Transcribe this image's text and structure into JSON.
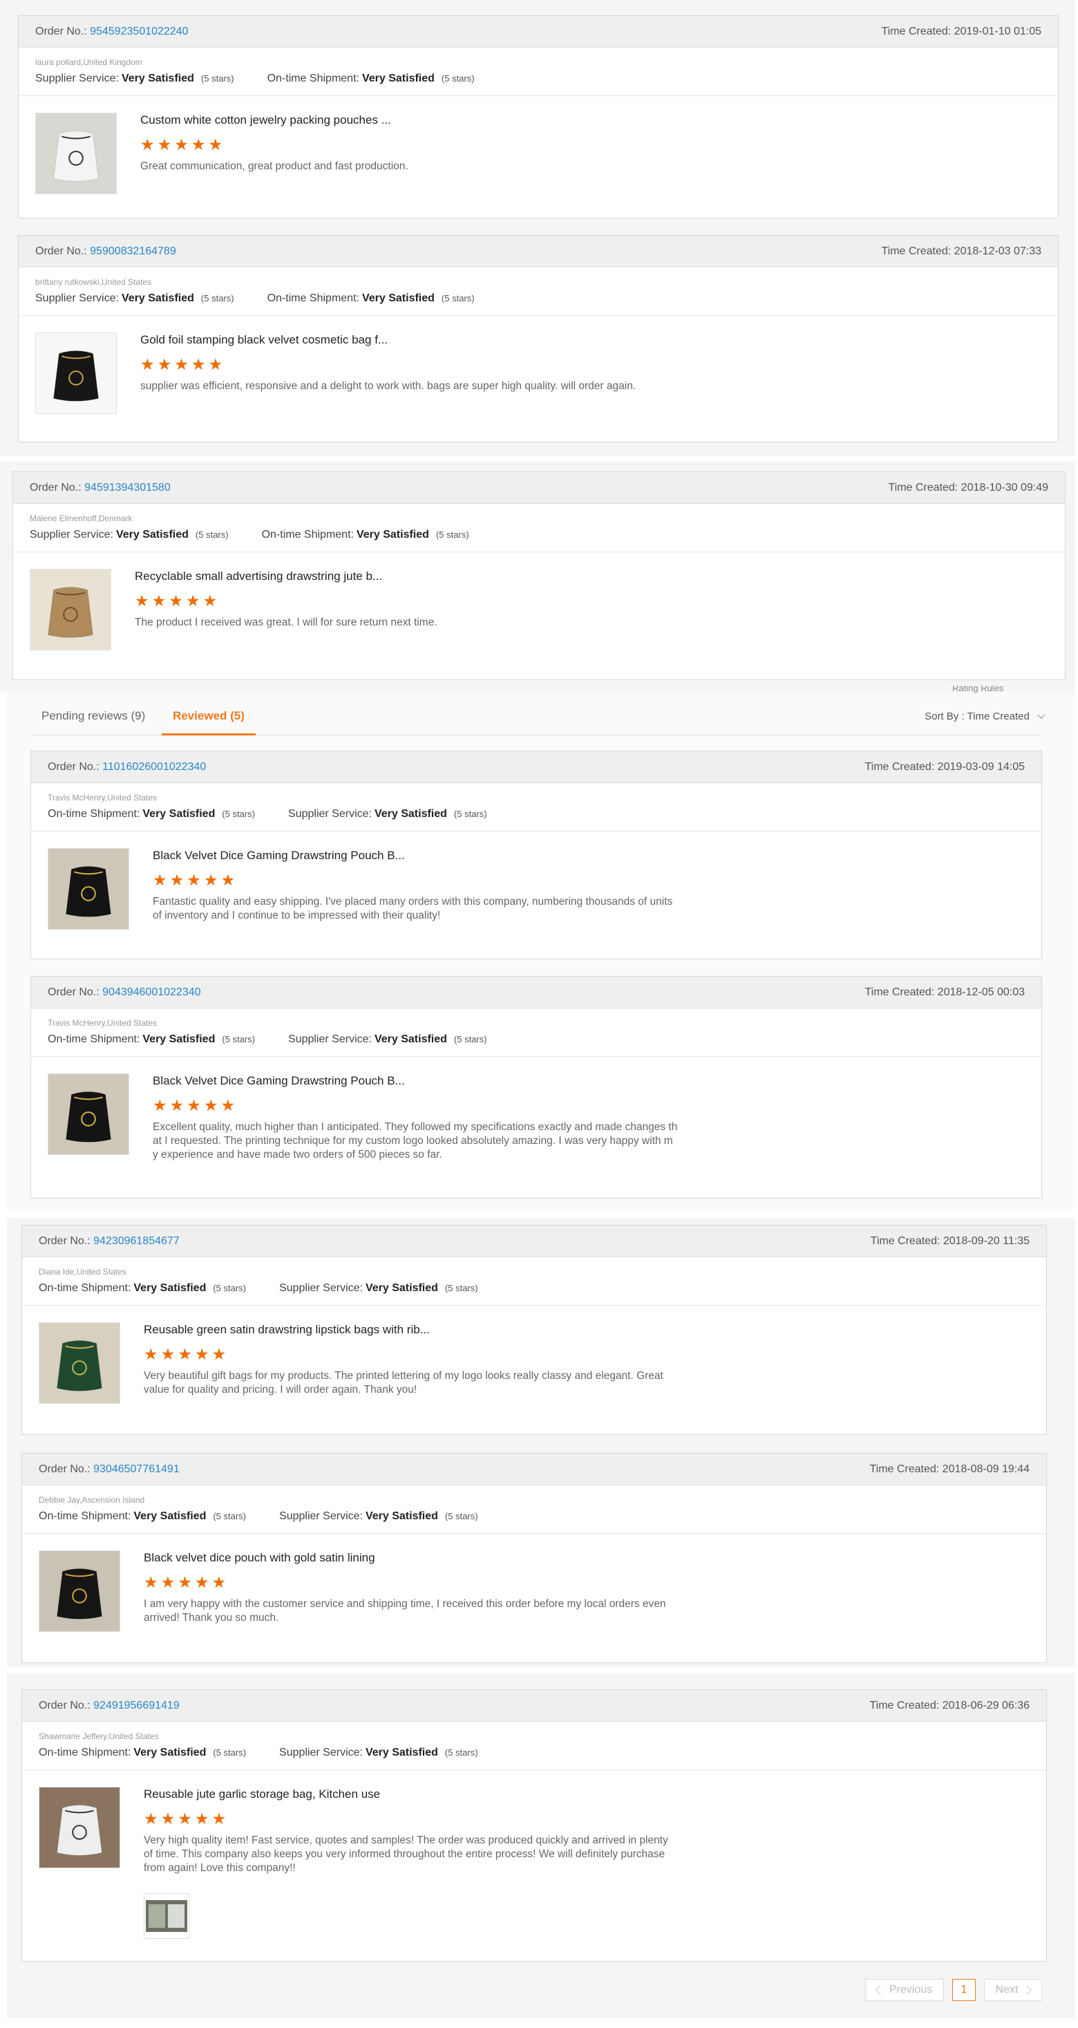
{
  "labels": {
    "order_no": "Order No.:",
    "time_created": "Time Created:",
    "supplier_service": "Supplier Service:",
    "ontime_shipment": "On-time Shipment:"
  },
  "tabs": {
    "pending": "Pending reviews (9)",
    "reviewed": "Reviewed (5)",
    "sort_by": "Sort By : Time Created",
    "rating_rules": "Rating Rules"
  },
  "pagination": {
    "previous": "Previous",
    "page": "1",
    "next": "Next"
  },
  "colors": {
    "accent": "#f07a1c",
    "link": "#2a86c9",
    "star": "#f06c00"
  },
  "orders": [
    {
      "order_no": "9545923501022240",
      "time": "2019-01-10 01:05",
      "buyer": "laura pollard,United Kingdom",
      "first": {
        "label": "Supplier Service:",
        "value": "Very Satisfied",
        "stars": "(5 stars)"
      },
      "second": {
        "label": "On-time Shipment:",
        "value": "Very Satisfied",
        "stars": "(5 stars)"
      },
      "product": "Custom white cotton jewelry packing pouches ...",
      "review": "Great communication, great product and fast production.",
      "rating": 5,
      "thumb_icon": "white-pouch-photo"
    },
    {
      "order_no": "95900832164789",
      "time": "2018-12-03 07:33",
      "buyer": "brittany rutkowski,United States",
      "first": {
        "label": "Supplier Service:",
        "value": "Very Satisfied",
        "stars": "(5 stars)"
      },
      "second": {
        "label": "On-time Shipment:",
        "value": "Very Satisfied",
        "stars": "(5 stars)"
      },
      "product": "Gold foil stamping black velvet cosmetic bag f...",
      "review": "supplier was efficient, responsive and a delight to work with. bags are super high quality. will order again.",
      "rating": 5,
      "thumb_icon": "black-velvet-bag-photo"
    },
    {
      "order_no": "94591394301580",
      "time": "2018-10-30 09:49",
      "buyer": "Malene Elmenhoff,Denmark",
      "first": {
        "label": "Supplier Service:",
        "value": "Very Satisfied",
        "stars": "(5 stars)"
      },
      "second": {
        "label": "On-time Shipment:",
        "value": "Very Satisfied",
        "stars": "(5 stars)"
      },
      "product": "Recyclable small advertising drawstring jute b...",
      "review": "The product I received was great. I will for sure return next time.",
      "rating": 5,
      "thumb_icon": "jute-bag-photo"
    },
    {
      "order_no": "11016026001022340",
      "time": "2019-03-09 14:05",
      "buyer": "Travis McHenry,United States",
      "first": {
        "label": "On-time Shipment:",
        "value": "Very Satisfied",
        "stars": "(5 stars)"
      },
      "second": {
        "label": "Supplier Service:",
        "value": "Very Satisfied",
        "stars": "(5 stars)"
      },
      "product": "Black Velvet Dice Gaming Drawstring Pouch B...",
      "review": "Fantastic quality and easy shipping.  I've placed many orders with this company, numbering thousands of units of inventory and I continue to be impressed with their quality!",
      "rating": 5,
      "thumb_icon": "dice-pouch-photo"
    },
    {
      "order_no": "9043946001022340",
      "time": "2018-12-05 00:03",
      "buyer": "Travis McHenry,United States",
      "first": {
        "label": "On-time Shipment:",
        "value": "Very Satisfied",
        "stars": "(5 stars)"
      },
      "second": {
        "label": "Supplier Service:",
        "value": "Very Satisfied",
        "stars": "(5 stars)"
      },
      "product": "Black Velvet Dice Gaming Drawstring Pouch B...",
      "review": "Excellent quality, much higher than I anticipated.  They followed my specifications exactly and made changes that I requested.  The printing technique for my custom logo looked absolutely amazing.  I was very happy with my experience and have made two orders of 500 pieces so far.",
      "rating": 5,
      "thumb_icon": "dice-pouch-photo"
    },
    {
      "order_no": "94230961854677",
      "time": "2018-09-20 11:35",
      "buyer": "Diana Ide,United States",
      "first": {
        "label": "On-time Shipment:",
        "value": "Very Satisfied",
        "stars": "(5 stars)"
      },
      "second": {
        "label": "Supplier Service:",
        "value": "Very Satisfied",
        "stars": "(5 stars)"
      },
      "product": "Reusable green satin drawstring lipstick bags with rib...",
      "review": "Very beautiful gift bags for my products. The printed lettering of my logo looks really classy and elegant. Great value for quality and pricing. I will order again. Thank you!",
      "rating": 5,
      "thumb_icon": "green-satin-bag-photo"
    },
    {
      "order_no": "93046507761491",
      "time": "2018-08-09 19:44",
      "buyer": "Debbie Jay,Ascension Island",
      "first": {
        "label": "On-time Shipment:",
        "value": "Very Satisfied",
        "stars": "(5 stars)"
      },
      "second": {
        "label": "Supplier Service:",
        "value": "Very Satisfied",
        "stars": "(5 stars)"
      },
      "product": "Black velvet dice pouch with gold satin lining",
      "review": "I am very happy with the customer service and shipping time, I received this order before my local orders even arrived! Thank you so much.",
      "rating": 5,
      "thumb_icon": "black-gold-pouch-photo"
    },
    {
      "order_no": "92491956691419",
      "time": "2018-06-29 06:36",
      "buyer": "Shawmarie Jeffery,United States",
      "first": {
        "label": "On-time Shipment:",
        "value": "Very Satisfied",
        "stars": "(5 stars)"
      },
      "second": {
        "label": "Supplier Service:",
        "value": "Very Satisfied",
        "stars": "(5 stars)"
      },
      "product": "Reusable jute garlic storage bag, Kitchen use",
      "review": "Very high quality item! Fast service, quotes and samples! The order was produced quickly and arrived in plenty of time. This company also keeps you very informed throughout the entire process! We will definitely purchase from again! Love this company!!",
      "rating": 5,
      "thumb_icon": "garlic-bag-photo"
    }
  ]
}
